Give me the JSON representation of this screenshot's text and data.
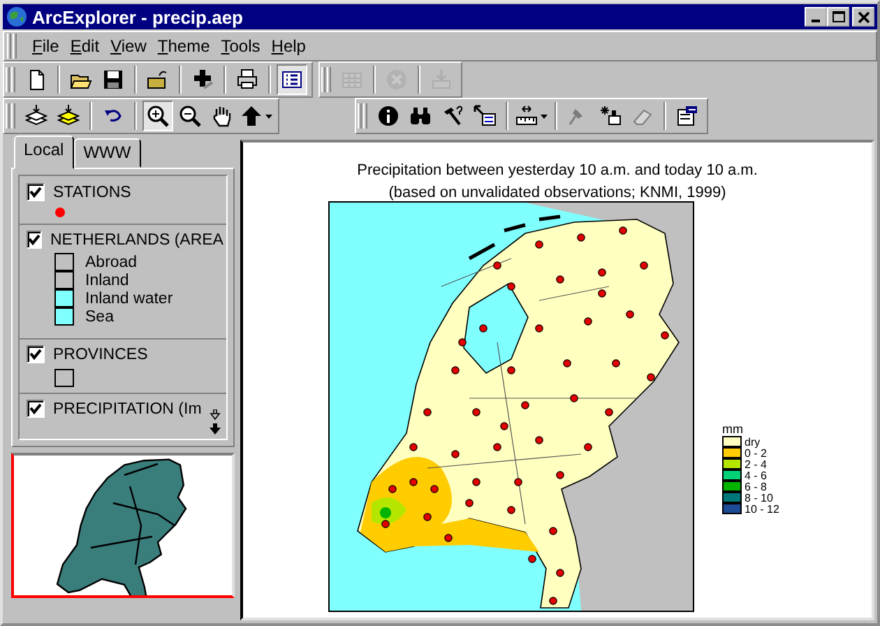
{
  "window": {
    "title": "ArcExplorer - precip.aep"
  },
  "menu": [
    "File",
    "Edit",
    "View",
    "Theme",
    "Tools",
    "Help"
  ],
  "toolbars": [
    {
      "groups": [
        [
          {
            "kind": "new",
            "pressed": false,
            "disabled": false
          }
        ],
        [
          {
            "kind": "open",
            "pressed": false,
            "disabled": false
          },
          {
            "kind": "save",
            "pressed": false,
            "disabled": false
          }
        ],
        [
          {
            "kind": "folderup",
            "pressed": false,
            "disabled": false
          }
        ],
        [
          {
            "kind": "addtheme",
            "pressed": false,
            "disabled": false
          }
        ],
        [
          {
            "kind": "print",
            "pressed": false,
            "disabled": false
          }
        ],
        [
          {
            "kind": "legend",
            "pressed": true,
            "disabled": false
          }
        ]
      ],
      "second": [
        [
          {
            "kind": "table",
            "pressed": false,
            "disabled": true
          }
        ],
        [
          {
            "kind": "remove",
            "pressed": false,
            "disabled": true
          }
        ],
        [
          {
            "kind": "download",
            "pressed": false,
            "disabled": true
          }
        ]
      ]
    },
    {
      "groups": [
        [
          {
            "kind": "layers",
            "pressed": false,
            "disabled": false
          },
          {
            "kind": "layersyellow",
            "pressed": false,
            "disabled": false
          }
        ],
        [
          {
            "kind": "undo",
            "pressed": false,
            "disabled": false
          }
        ],
        [
          {
            "kind": "zoomin",
            "pressed": true,
            "disabled": false
          },
          {
            "kind": "zoomout",
            "pressed": false,
            "disabled": false
          },
          {
            "kind": "pan",
            "pressed": false,
            "disabled": false
          },
          {
            "kind": "arrow",
            "pressed": false,
            "disabled": false,
            "dropdown": true
          }
        ]
      ],
      "second": [
        [
          {
            "kind": "info",
            "pressed": false,
            "disabled": false
          },
          {
            "kind": "find",
            "pressed": false,
            "disabled": false
          },
          {
            "kind": "hammer",
            "pressed": false,
            "disabled": false
          },
          {
            "kind": "select",
            "pressed": false,
            "disabled": false
          }
        ],
        [
          {
            "kind": "measure",
            "pressed": false,
            "disabled": false,
            "dropdown": true
          }
        ],
        [
          {
            "kind": "pin",
            "pressed": false,
            "disabled": true
          },
          {
            "kind": "spark",
            "pressed": false,
            "disabled": false
          },
          {
            "kind": "eraser",
            "pressed": false,
            "disabled": true
          }
        ],
        [
          {
            "kind": "properties",
            "pressed": false,
            "disabled": false
          }
        ]
      ]
    }
  ],
  "tabs": [
    {
      "label": "Local",
      "selected": true
    },
    {
      "label": "WWW",
      "selected": false
    }
  ],
  "layers": [
    {
      "name": "STATIONS",
      "checked": true,
      "kind": "point",
      "color": "#ff0000"
    },
    {
      "name": "NETHERLANDS (AREA",
      "checked": true,
      "kind": "classes",
      "classes": [
        {
          "label": "Abroad",
          "color": "#c0c0c0"
        },
        {
          "label": "Inland",
          "color": "#c0c0c0"
        },
        {
          "label": "Inland water",
          "color": "#80ffff"
        },
        {
          "label": "Sea",
          "color": "#80ffff"
        }
      ]
    },
    {
      "name": "PROVINCES",
      "checked": true,
      "kind": "fill",
      "color": "#c0c0c0"
    },
    {
      "name": "PRECIPITATION (Im",
      "checked": true,
      "kind": "none"
    }
  ],
  "map": {
    "title": "Precipitation between yesterday 10 a.m. and today 10 a.m.",
    "subtitle": "(based on unvalidated observations; KNMI, 1999)",
    "legend": {
      "unit": "mm",
      "classes": [
        {
          "label": "dry",
          "color": "#ffffc0"
        },
        {
          "label": "0 - 2",
          "color": "#ffcc00"
        },
        {
          "label": "2 - 4",
          "color": "#b4e600"
        },
        {
          "label": "4 - 6",
          "color": "#00d278"
        },
        {
          "label": "6 - 8",
          "color": "#00b400"
        },
        {
          "label": "8 - 10",
          "color": "#00787a"
        },
        {
          "label": "10 - 12",
          "color": "#1e4b96"
        }
      ]
    }
  }
}
